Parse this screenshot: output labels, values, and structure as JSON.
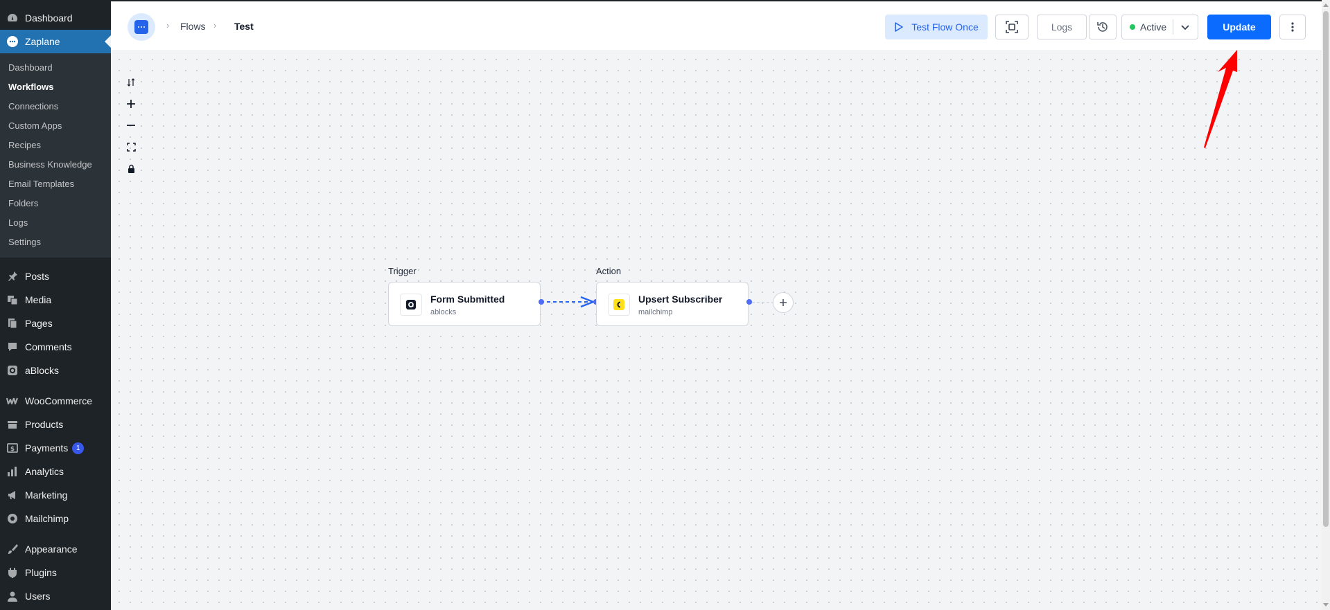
{
  "sidebar": {
    "top_items": [
      {
        "label": "Dashboard",
        "icon": "dashboard-icon"
      },
      {
        "label": "Zaplane",
        "icon": "zaplane-icon"
      }
    ],
    "submenu": [
      {
        "label": "Dashboard"
      },
      {
        "label": "Workflows"
      },
      {
        "label": "Connections"
      },
      {
        "label": "Custom Apps"
      },
      {
        "label": "Recipes"
      },
      {
        "label": "Business Knowledge"
      },
      {
        "label": "Email Templates"
      },
      {
        "label": "Folders"
      },
      {
        "label": "Logs"
      },
      {
        "label": "Settings"
      }
    ],
    "group1": [
      {
        "label": "Posts",
        "icon": "pin-icon"
      },
      {
        "label": "Media",
        "icon": "media-icon"
      },
      {
        "label": "Pages",
        "icon": "pages-icon"
      },
      {
        "label": "Comments",
        "icon": "comment-icon"
      },
      {
        "label": "aBlocks",
        "icon": "ablocks-icon"
      }
    ],
    "group2": [
      {
        "label": "WooCommerce",
        "icon": "woo-icon"
      },
      {
        "label": "Products",
        "icon": "products-icon"
      },
      {
        "label": "Payments",
        "icon": "payments-icon",
        "badge": "1"
      },
      {
        "label": "Analytics",
        "icon": "analytics-icon"
      },
      {
        "label": "Marketing",
        "icon": "megaphone-icon"
      },
      {
        "label": "Mailchimp",
        "icon": "mailchimp-icon"
      }
    ],
    "group3": [
      {
        "label": "Appearance",
        "icon": "brush-icon"
      },
      {
        "label": "Plugins",
        "icon": "plugin-icon"
      },
      {
        "label": "Users",
        "icon": "user-icon"
      }
    ]
  },
  "header": {
    "breadcrumb": [
      "Flows",
      "Test"
    ],
    "test_flow_label": "Test Flow Once",
    "logs_label": "Logs",
    "status_label": "Active",
    "update_label": "Update"
  },
  "canvas": {
    "trigger": {
      "section_label": "Trigger",
      "title": "Form Submitted",
      "app": "ablocks"
    },
    "action": {
      "section_label": "Action",
      "title": "Upsert Subscriber",
      "app": "mailchimp"
    }
  },
  "colors": {
    "accent": "#0b6bff",
    "sidebar_bg": "#1d2327",
    "active_menu": "#2271b1",
    "status_active": "#22c55e",
    "annotation_arrow": "#ff0000"
  }
}
